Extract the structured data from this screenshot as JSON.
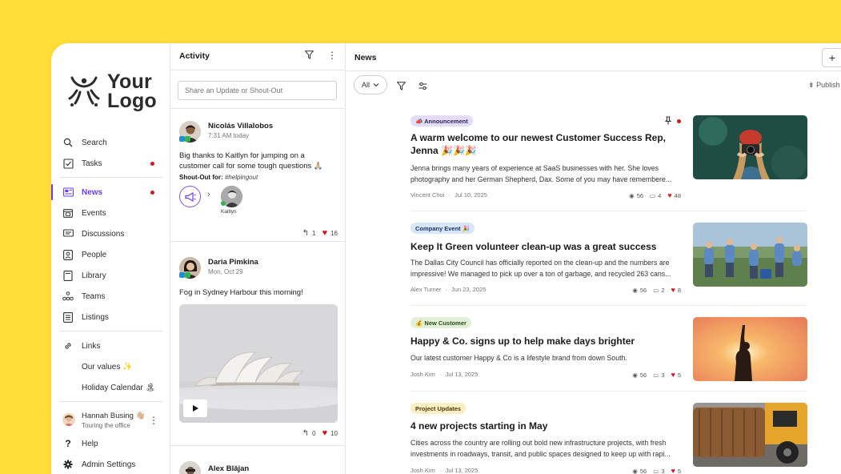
{
  "logo": {
    "line1": "Your",
    "line2": "Logo"
  },
  "sidebar": {
    "items": [
      {
        "label": "Search",
        "icon": "search-icon"
      },
      {
        "label": "Tasks",
        "icon": "tasks-icon",
        "dot": true
      },
      {
        "label": "News",
        "icon": "news-icon",
        "dot": true,
        "active": true
      },
      {
        "label": "Events",
        "icon": "calendar-icon"
      },
      {
        "label": "Discussions",
        "icon": "discussions-icon"
      },
      {
        "label": "People",
        "icon": "people-icon"
      },
      {
        "label": "Library",
        "icon": "library-icon"
      },
      {
        "label": "Teams",
        "icon": "teams-icon"
      },
      {
        "label": "Listings",
        "icon": "listings-icon"
      },
      {
        "label": "Links",
        "icon": "link-icon"
      },
      {
        "label": "Our values ✨",
        "icon": ""
      },
      {
        "label": "Holiday Calendar 🏝",
        "icon": ""
      }
    ],
    "user": {
      "name": "Hannah Busing 👋🏼",
      "status": "Touring the office"
    },
    "help": "Help",
    "admin": "Admin Settings"
  },
  "activity": {
    "title": "Activity",
    "share_placeholder": "Share an Update or Shout-Out",
    "posts": [
      {
        "name": "Nicolás Villalobos",
        "time": "7:31 AM today",
        "body": "Big thanks to Kaitlyn for jumping on a customer call for some tough questions 🙏🏼",
        "shoutout_label": "Shout-Out for:",
        "shoutout_tag": "#helpingout",
        "recipient": "Kaitlyn",
        "replies": "1",
        "likes": "16"
      },
      {
        "name": "Daria Pimkina",
        "time": "Mon, Oct 29",
        "body": "Fog in Sydney Harbour this morning!",
        "replies": "0",
        "likes": "10"
      },
      {
        "name": "Alex Blăjan"
      }
    ]
  },
  "news": {
    "title": "News",
    "filter_all": "All",
    "published_label": "Publish",
    "articles": [
      {
        "tag": "📣 Announcement",
        "tag_bg": "#e3dcfb",
        "title": "A warm welcome to our newest Customer Success Rep, Jenna 🎉🎉🎉",
        "excerpt": "Jenna brings many years of experience at SaaS businesses with her. She loves photography and her German Shepherd, Dax. Some of you may have remembere...",
        "author": "Vincent Choi",
        "date": "Jul 10, 2025",
        "views": "56",
        "comments": "4",
        "likes": "48",
        "pinned": true
      },
      {
        "tag": "Company Event 🎉",
        "tag_bg": "#d8e6fb",
        "title": "Keep It Green volunteer clean-up was a great success",
        "excerpt": "The Dallas City Council has officially reported on the clean-up and the numbers are impressive! We managed to pick up over a ton of garbage, and recycled 263 cans...",
        "author": "Alex Turner",
        "date": "Jun 23, 2025",
        "views": "56",
        "comments": "2",
        "likes": "8"
      },
      {
        "tag": "💰 New Customer",
        "tag_bg": "#e2f0d8",
        "title": "Happy & Co. signs up to help make days brighter",
        "excerpt": "Our latest customer Happy & Co is a lifestyle brand from down South.",
        "author": "Josh Kim",
        "date": "Jul 13, 2025",
        "views": "56",
        "comments": "3",
        "likes": "5"
      },
      {
        "tag": "Project Updates",
        "tag_bg": "#fbefc2",
        "title": "4 new projects starting in May",
        "excerpt": "Cities across the country are rolling out bold new infrastructure projects, with fresh investments in roadways, transit, and public spaces designed to keep up with rapi...",
        "author": "Josh Kim",
        "date": "Jul 13, 2025",
        "views": "56",
        "comments": "3",
        "likes": "5"
      }
    ]
  }
}
